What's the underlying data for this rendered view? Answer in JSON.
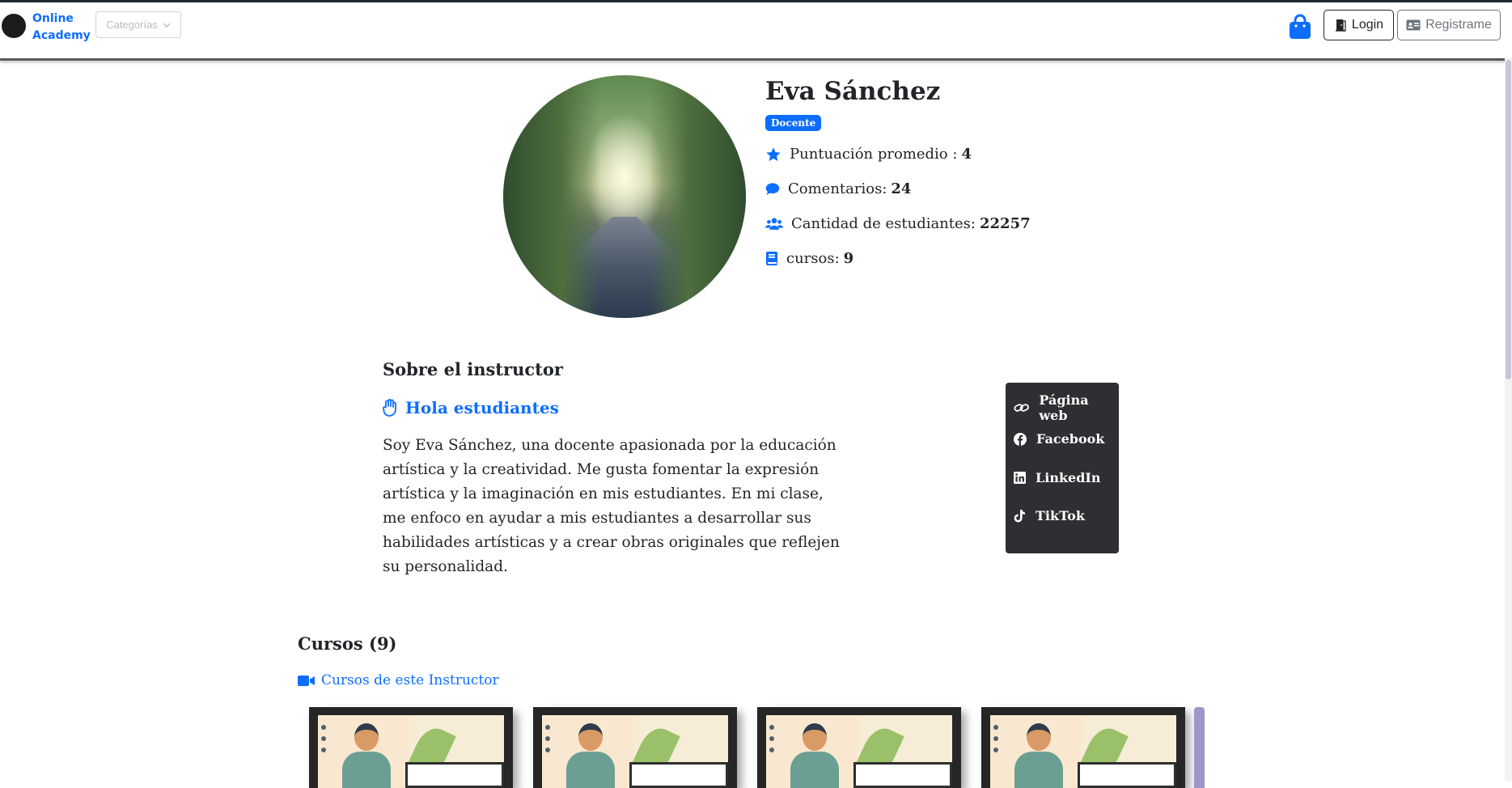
{
  "header": {
    "brand_line1": "Online",
    "brand_line2": "Academy",
    "categories_label": "Categorías",
    "login_label": "Login",
    "register_label": "Registrame"
  },
  "profile": {
    "name": "Eva Sánchez",
    "role_badge": "Docente",
    "rating_label": "Puntuación promedio :",
    "rating_value": "4",
    "comments_label": "Comentarios:",
    "comments_value": "24",
    "students_label": "Cantidad de estudiantes:",
    "students_value": "22257",
    "courses_label": "cursos:",
    "courses_value": "9"
  },
  "about": {
    "title": "Sobre el instructor",
    "greeting": "Hola estudiantes",
    "bio": "Soy Eva Sánchez, una docente apasionada por la educación artística y la creatividad. Me gusta fomentar la expresión artística y la imaginación en mis estudiantes. En mi clase, me enfoco en ayudar a mis estudiantes a desarrollar sus habilidades artísticas y a crear obras originales que reflejen su personalidad."
  },
  "social": {
    "web": "Página web",
    "facebook": "Facebook",
    "linkedin": "LinkedIn",
    "tiktok": "TikTok"
  },
  "courses": {
    "title": "Cursos (9)",
    "link": "Cursos de este Instructor"
  },
  "colors": {
    "accent": "#0d6efd",
    "social_bg": "#2f2f33"
  }
}
